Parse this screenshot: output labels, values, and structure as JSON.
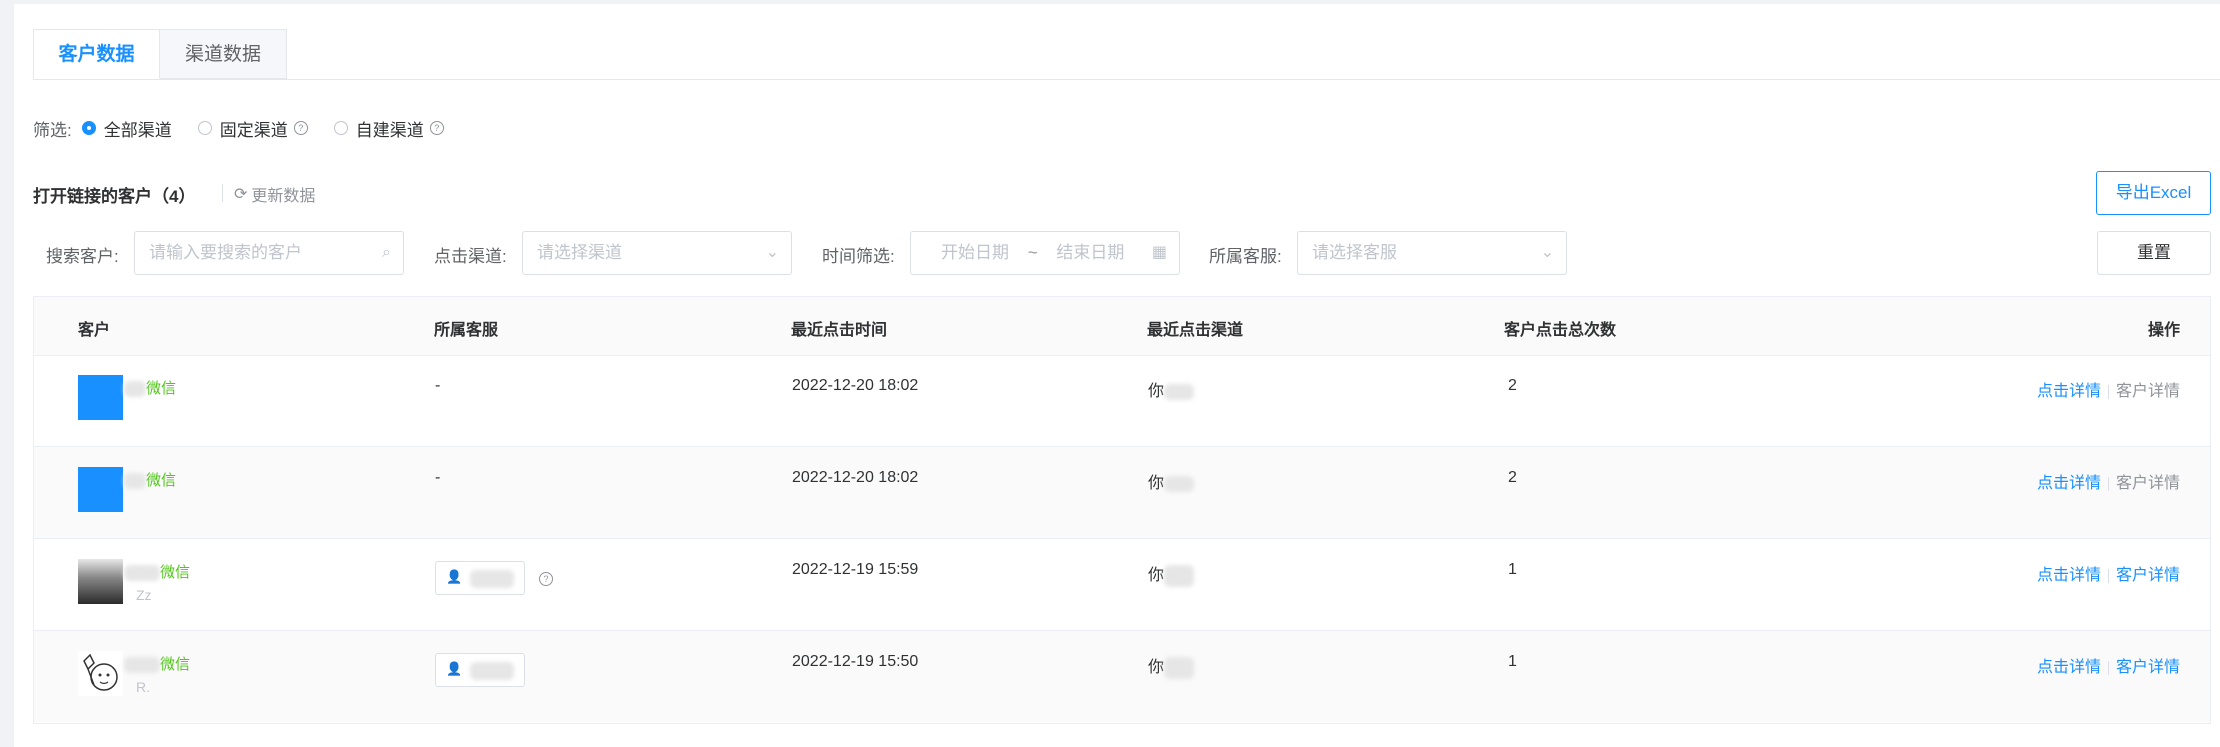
{
  "tabs": [
    {
      "label": "客户数据",
      "active": true
    },
    {
      "label": "渠道数据",
      "active": false
    }
  ],
  "filter": {
    "label": "筛选:",
    "options": [
      {
        "label": "全部渠道",
        "checked": true
      },
      {
        "label": "固定渠道",
        "checked": false,
        "help": "?"
      },
      {
        "label": "自建渠道",
        "checked": false,
        "help": "?"
      }
    ]
  },
  "section": {
    "title": "打开链接的客户（4）",
    "refresh_label": "更新数据",
    "export_label": "导出Excel"
  },
  "search": {
    "customer_label": "搜索客户:",
    "customer_placeholder": "请输入要搜索的客户",
    "channel_label": "点击渠道:",
    "channel_placeholder": "请选择渠道",
    "time_label": "时间筛选:",
    "start_placeholder": "开始日期",
    "range_sep": "~",
    "end_placeholder": "结束日期",
    "agent_label": "所属客服:",
    "agent_placeholder": "请选择客服",
    "reset_label": "重置"
  },
  "table": {
    "headers": [
      "客户",
      "所属客服",
      "最近点击时间",
      "最近点击渠道",
      "客户点击总次数",
      "操作"
    ],
    "rows": [
      {
        "source": "微信",
        "sub": "",
        "agent": "-",
        "time": "2022-12-20 18:02",
        "channel": "你",
        "count": "2",
        "op1": "点击详情",
        "op2": "客户详情",
        "op2_active": false
      },
      {
        "source": "微信",
        "sub": "",
        "agent": "-",
        "time": "2022-12-20 18:02",
        "channel": "你",
        "count": "2",
        "op1": "点击详情",
        "op2": "客户详情",
        "op2_active": false
      },
      {
        "source": "微信",
        "sub": "Zz",
        "agent": "",
        "time": "2022-12-19 15:59",
        "channel": "你",
        "count": "1",
        "op1": "点击详情",
        "op2": "客户详情",
        "op2_active": true
      },
      {
        "source": "微信",
        "sub": "R.",
        "agent": "",
        "time": "2022-12-19 15:50",
        "channel": "你",
        "count": "1",
        "op1": "点击详情",
        "op2": "客户详情",
        "op2_active": true
      }
    ]
  },
  "colors": {
    "accent": "#1890ff",
    "wechat": "#52c41a",
    "muted": "#909399"
  }
}
